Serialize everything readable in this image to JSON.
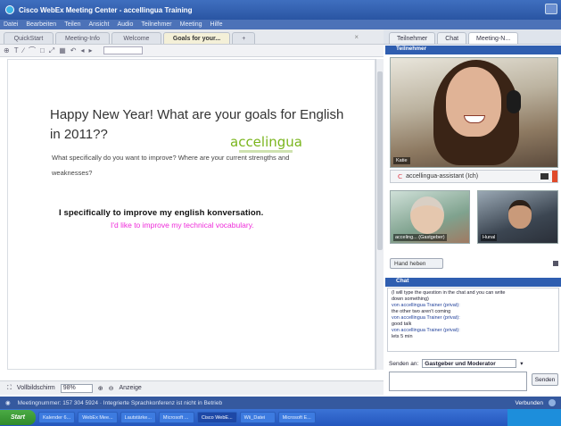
{
  "window": {
    "title": "Cisco WebEx Meeting Center - accellingua Training"
  },
  "menu": [
    "Datei",
    "Bearbeiten",
    "Teilen",
    "Ansicht",
    "Audio",
    "Teilnehmer",
    "Meeting",
    "Hilfe"
  ],
  "doc_tabs": {
    "items": [
      "QuickStart",
      "Meeting-Info",
      "Welcome",
      "Goals for your..."
    ],
    "add_label": "+",
    "close_label": "×"
  },
  "toolbar": {
    "icons": [
      "⊕",
      "T",
      "∕",
      "⌒",
      "□",
      "⤢",
      "▦",
      "↶",
      "◂",
      "▸"
    ]
  },
  "whiteboard": {
    "heading": "Happy New Year! What are your goals for English in 2011??",
    "brand": "accelingua",
    "question": "What specifically do you want to improve? Where are your current strengths and weaknesses?",
    "answer1": "I specifically to improve my english konversation.",
    "answer2": "I'd like to improve my technical vocabulary."
  },
  "board_status": {
    "view_label": "Vollbildschirm",
    "zoom": "98%",
    "arrange_label": "Anzeige"
  },
  "right_tabs": [
    "Teilnehmer",
    "Chat",
    "Meeting-N..."
  ],
  "video": {
    "header": "Teilnehmer",
    "active_speaker_label": "Katie",
    "speaker_name": "accellingua-assistant (Ich)",
    "thumb1_label": "acceling... (Gastgeber)",
    "thumb2_label": "Hunal"
  },
  "hand_raise_label": "Hand heben",
  "chat": {
    "header": "Chat",
    "lines": [
      {
        "text": "(I will type the question in the chat and you can write"
      },
      {
        "text": "down something)"
      },
      {
        "from": "von accellingua Trainer (privat):"
      },
      {
        "text": "the other two aren't coming"
      },
      {
        "from": "von accellingua Trainer (privat):"
      },
      {
        "text": "good talk"
      },
      {
        "from": "von accellingua Trainer (privat):"
      },
      {
        "text": "lets 5 min"
      }
    ],
    "to_label": "Senden an:",
    "to_value": "Gastgeber und Moderator",
    "send_label": "Senden"
  },
  "info_bar": {
    "text": "Meetingnummer: 157 304 5924 · Integrierte Sprachkonferenz ist nicht in Betrieb",
    "right_text": "Verbunden"
  },
  "taskbar": {
    "start_label": "Start",
    "items": [
      "Kalender 6...",
      "WebEx Mee...",
      "Lautstärke...",
      "Microsoft ...",
      "Cisco WebE...",
      "Wii_Datei",
      "Microsoft E..."
    ],
    "active_index": 4
  }
}
